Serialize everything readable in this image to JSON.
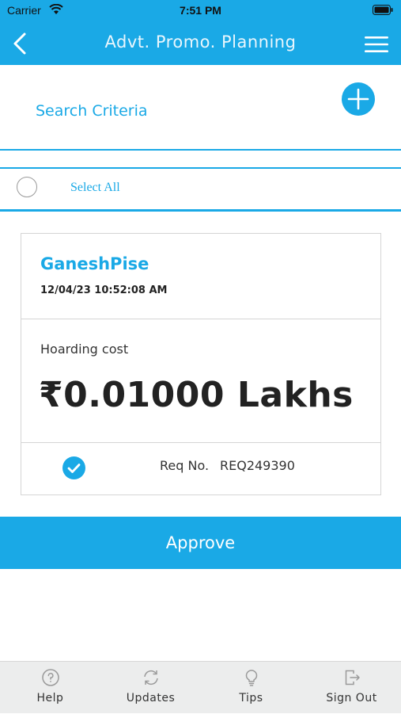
{
  "status_bar": {
    "carrier": "Carrier",
    "time": "7:51 PM"
  },
  "nav": {
    "title": "Advt. Promo. Planning"
  },
  "search": {
    "label": "Search Criteria"
  },
  "select_all": {
    "label": "Select All"
  },
  "card": {
    "name": "GaneshPise",
    "datetime": "12/04/23 10:52:08 AM",
    "cost_label": "Hoarding cost",
    "cost_value": "₹0.01000 Lakhs",
    "req_label": "Req No.",
    "req_value": "REQ249390"
  },
  "approve_label": "Approve",
  "tabs": [
    {
      "label": "Help",
      "icon": "help-icon"
    },
    {
      "label": "Updates",
      "icon": "refresh-icon"
    },
    {
      "label": "Tips",
      "icon": "lightbulb-icon"
    },
    {
      "label": "Sign Out",
      "icon": "sign-out-icon"
    }
  ],
  "colors": {
    "accent": "#1aa9e6",
    "tab_bar": "#eceded"
  }
}
